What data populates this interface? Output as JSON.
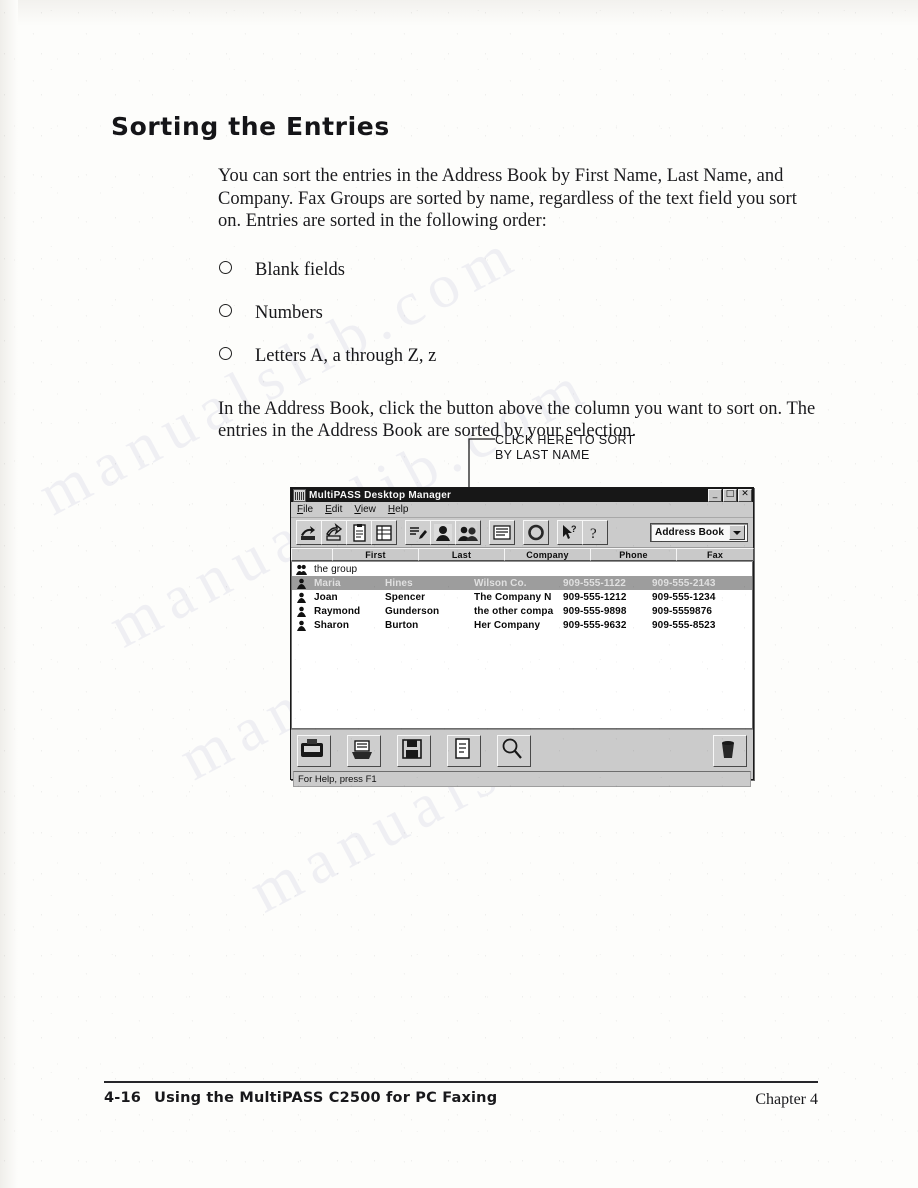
{
  "page": {
    "heading": "Sorting the Entries",
    "paragraph_1": "You can sort the entries in the Address Book by First Name, Last Name, and Company. Fax Groups are sorted by name, regardless of the text field you sort on. Entries are sorted in the following order:",
    "bullets": [
      "Blank fields",
      "Numbers",
      "Letters A, a through Z, z"
    ],
    "paragraph_2": "In the Address Book, click the button above the column you want to sort on. The entries in the Address Book are sorted by your selection.",
    "callout": "CLICK HERE TO SORT\nBY LAST NAME",
    "watermark": "manualslib.com"
  },
  "footer": {
    "page_number": "4-16",
    "title": "Using the MultiPASS C2500 for PC Faxing",
    "chapter": "Chapter 4"
  },
  "window": {
    "title": "MultiPASS Desktop Manager",
    "title_icon": "app-icon",
    "controls": {
      "minimize": "_",
      "maximize": "□",
      "close": "✕"
    },
    "menus": [
      {
        "label": "File",
        "accel": "F"
      },
      {
        "label": "Edit",
        "accel": "E"
      },
      {
        "label": "View",
        "accel": "V"
      },
      {
        "label": "Help",
        "accel": "H"
      }
    ],
    "toolbar_groups": [
      [
        "send-fax-icon",
        "receive-fax-icon",
        "clipboard-icon",
        "list-icon"
      ],
      [
        "edit-entry-icon",
        "person-icon",
        "group-people-icon"
      ],
      [
        "document-icon"
      ],
      [
        "ring-icon"
      ],
      [
        "help-pointer-icon",
        "help-question-icon"
      ]
    ],
    "folder_selector": {
      "label": "Address Book",
      "arrow": "chevron-down-icon"
    },
    "columns": [
      "First",
      "Last",
      "Company",
      "Phone",
      "Fax"
    ],
    "rows": [
      {
        "icon": "group-icon",
        "first": "the group",
        "last": "",
        "company": "",
        "phone": "",
        "fax": "",
        "selected": false,
        "is_group": true
      },
      {
        "icon": "person-icon",
        "first": "Maria",
        "last": "Hines",
        "company": "Wilson Co.",
        "phone": "909-555-1122",
        "fax": "909-555-2143",
        "selected": true,
        "is_group": false
      },
      {
        "icon": "person-icon",
        "first": "Joan",
        "last": "Spencer",
        "company": "The Company N",
        "phone": "909-555-1212",
        "fax": "909-555-1234",
        "selected": false,
        "is_group": false
      },
      {
        "icon": "person-icon",
        "first": "Raymond",
        "last": "Gunderson",
        "company": "the other compa",
        "phone": "909-555-9898",
        "fax": "909-5559876",
        "selected": false,
        "is_group": false
      },
      {
        "icon": "person-icon",
        "first": "Sharon",
        "last": "Burton",
        "company": "Her Company",
        "phone": "909-555-9632",
        "fax": "909-555-8523",
        "selected": false,
        "is_group": false
      }
    ],
    "bottom_buttons": [
      "fax-machine-icon",
      "printer-icon",
      "save-disk-icon",
      "document-icon",
      "search-icon"
    ],
    "trash_button": "trash-icon",
    "status_text": "For Help, press F1"
  }
}
